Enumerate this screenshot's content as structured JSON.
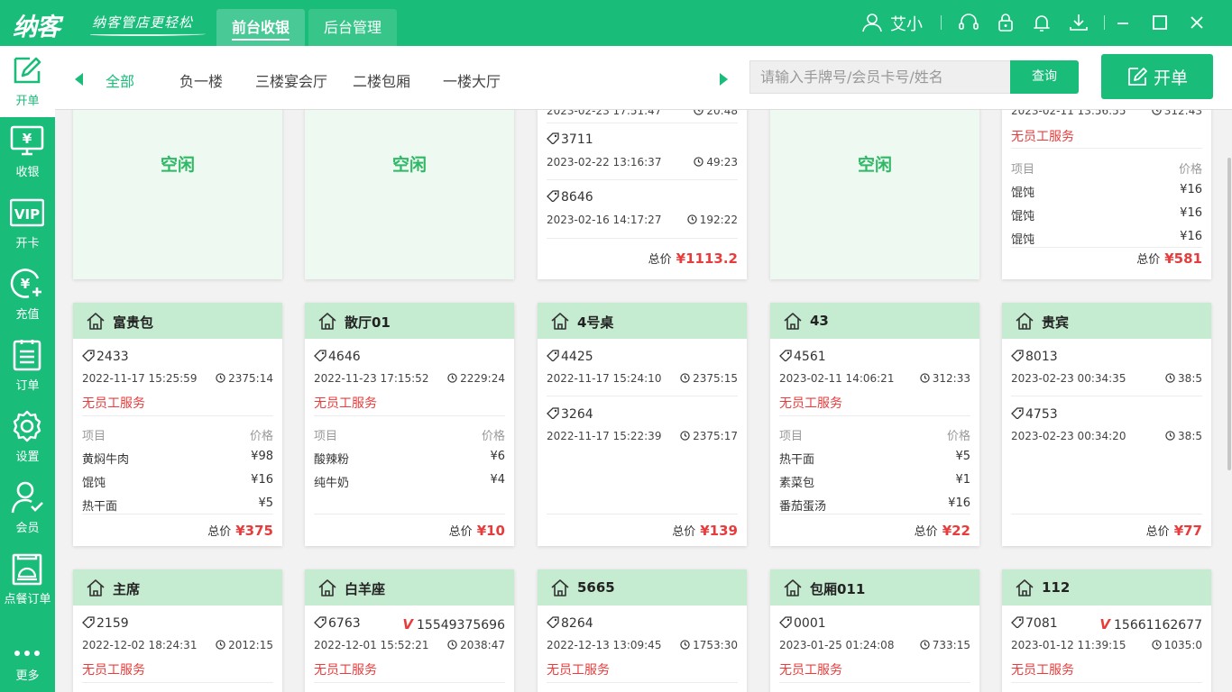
{
  "app": {
    "logo": "纳客",
    "slogan": "纳客管店更轻松",
    "tabs": [
      {
        "label": "前台收银",
        "active": true
      },
      {
        "label": "后台管理",
        "active": false
      }
    ],
    "user": "艾小",
    "colors": {
      "primary": "#1abc7a",
      "danger": "#e83c3c",
      "card_header": "#c5ebd1",
      "idle_bg": "#eef9f1"
    }
  },
  "sidebar": {
    "items": [
      {
        "label": "开单",
        "icon": "edit-order-icon",
        "active": true
      },
      {
        "label": "收银",
        "icon": "cashier-monitor-icon",
        "active": false
      },
      {
        "label": "开卡",
        "icon": "vip-card-icon",
        "active": false
      },
      {
        "label": "充值",
        "icon": "recharge-icon",
        "active": false
      },
      {
        "label": "订单",
        "icon": "order-list-icon",
        "active": false
      },
      {
        "label": "设置",
        "icon": "gear-icon",
        "active": false
      },
      {
        "label": "会员",
        "icon": "member-icon",
        "active": false
      },
      {
        "label": "点餐订单",
        "icon": "dining-order-icon",
        "active": false
      },
      {
        "label": "更多",
        "icon": "more-icon",
        "active": false
      }
    ]
  },
  "nav": {
    "tabs": [
      "全部",
      "负一楼",
      "三楼宴会厅",
      "二楼包厢",
      "一楼大厅"
    ],
    "active_tab": "全部",
    "search_placeholder": "请输入手牌号/会员卡号/姓名",
    "search_button": "查询",
    "open_order_button": "开单"
  },
  "labels": {
    "idle": "空闲",
    "no_staff": "无员工服务",
    "item": "项目",
    "price": "价格",
    "total": "总价"
  },
  "row1": [
    {
      "status": "idle"
    },
    {
      "status": "idle"
    },
    {
      "status": "busy",
      "partial_time": "2023-02-23 17:51:47",
      "partial_duration": "20:48",
      "tickets": [
        {
          "id": "3711",
          "time": "2023-02-22 13:16:37",
          "duration": "49:23"
        },
        {
          "id": "8646",
          "time": "2023-02-16 14:17:27",
          "duration": "192:22"
        }
      ],
      "total": "¥1113.2"
    },
    {
      "status": "idle"
    },
    {
      "status": "busy",
      "partial_time": "2023-02-11 13:56:55",
      "partial_duration": "312:43",
      "no_staff": true,
      "items": [
        {
          "name": "馄饨",
          "price": "¥16"
        },
        {
          "name": "馄饨",
          "price": "¥16"
        },
        {
          "name": "馄饨",
          "price": "¥16"
        }
      ],
      "total": "¥581"
    }
  ],
  "row2": [
    {
      "name": "富贵包",
      "tickets": [
        {
          "id": "2433",
          "time": "2022-11-17 15:25:59",
          "duration": "2375:14"
        }
      ],
      "no_staff": true,
      "items": [
        {
          "name": "黄焖牛肉",
          "price": "¥98"
        },
        {
          "name": "馄饨",
          "price": "¥16"
        },
        {
          "name": "热干面",
          "price": "¥5"
        }
      ],
      "total": "¥375"
    },
    {
      "name": "散厅01",
      "tickets": [
        {
          "id": "4646",
          "time": "2022-11-23 17:15:52",
          "duration": "2229:24"
        }
      ],
      "no_staff": true,
      "items": [
        {
          "name": "酸辣粉",
          "price": "¥6"
        },
        {
          "name": "纯牛奶",
          "price": "¥4"
        }
      ],
      "total": "¥10"
    },
    {
      "name": "4号桌",
      "tickets": [
        {
          "id": "4425",
          "time": "2022-11-17 15:24:10",
          "duration": "2375:15"
        },
        {
          "id": "3264",
          "time": "2022-11-17 15:22:39",
          "duration": "2375:17"
        }
      ],
      "no_staff": false,
      "items": [],
      "total": "¥139"
    },
    {
      "name": "43",
      "tickets": [
        {
          "id": "4561",
          "time": "2023-02-11 14:06:21",
          "duration": "312:33"
        }
      ],
      "no_staff": true,
      "items": [
        {
          "name": "热干面",
          "price": "¥5"
        },
        {
          "name": "素菜包",
          "price": "¥1"
        },
        {
          "name": "番茄蛋汤",
          "price": "¥16"
        }
      ],
      "total": "¥22"
    },
    {
      "name": "贵宾",
      "tickets": [
        {
          "id": "8013",
          "time": "2023-02-23 00:34:35",
          "duration": "38:5"
        },
        {
          "id": "4753",
          "time": "2023-02-23 00:34:20",
          "duration": "38:5"
        }
      ],
      "no_staff": false,
      "items": [],
      "total": "¥77"
    }
  ],
  "row3": [
    {
      "name": "主席",
      "ticket": "2159",
      "phone": "",
      "time": "2022-12-02 18:24:31",
      "duration": "2012:15"
    },
    {
      "name": "白羊座",
      "ticket": "6763",
      "phone": "15549375696",
      "time": "2022-12-01 15:52:21",
      "duration": "2038:47"
    },
    {
      "name": "5665",
      "ticket": "8264",
      "phone": "",
      "time": "2022-12-13 13:09:45",
      "duration": "1753:30"
    },
    {
      "name": "包厢011",
      "ticket": "0001",
      "phone": "",
      "time": "2023-01-25 01:24:08",
      "duration": "733:15"
    },
    {
      "name": "112",
      "ticket": "7081",
      "phone": "15661162677",
      "time": "2023-01-12 11:39:15",
      "duration": "1035:0"
    }
  ]
}
